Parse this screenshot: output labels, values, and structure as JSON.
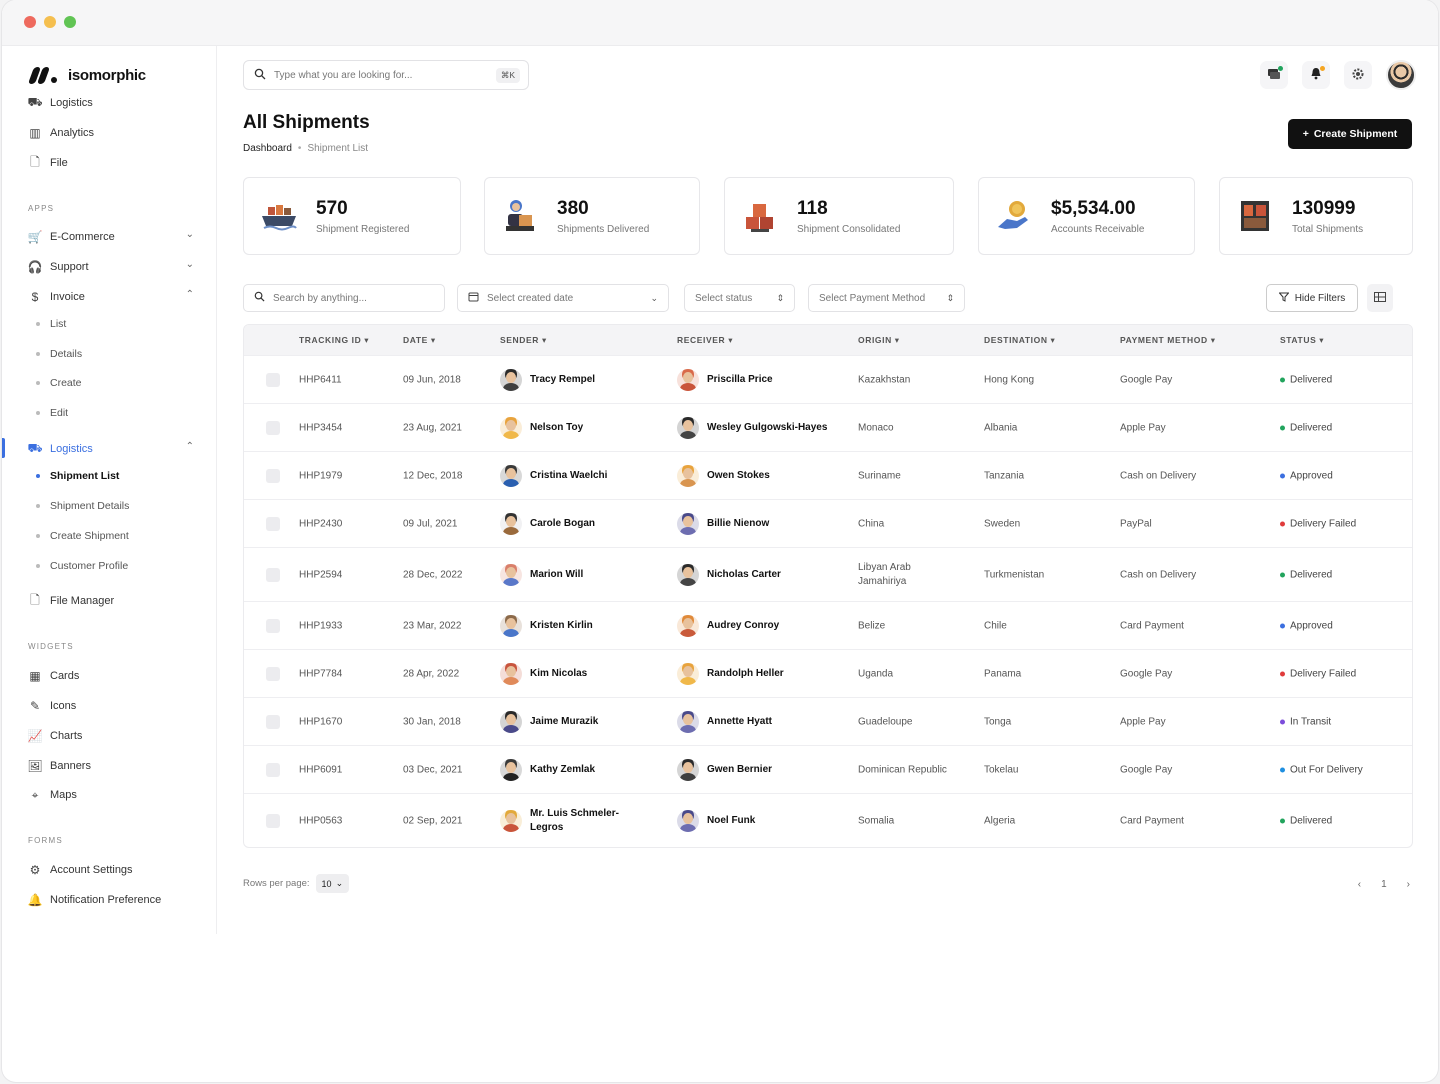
{
  "app": {
    "name": "isomorphic"
  },
  "sidebar": {
    "top_items": [
      {
        "label": "Logistics",
        "icon": "truck-icon"
      },
      {
        "label": "Analytics",
        "icon": "chart-bar-icon"
      },
      {
        "label": "File",
        "icon": "file-icon"
      }
    ],
    "apps_title": "APPS",
    "apps": [
      {
        "label": "E-Commerce",
        "icon": "cart-icon"
      },
      {
        "label": "Support",
        "icon": "headset-icon"
      },
      {
        "label": "Invoice",
        "icon": "dollar-icon"
      }
    ],
    "invoice_sub": [
      "List",
      "Details",
      "Create",
      "Edit"
    ],
    "logistics": {
      "label": "Logistics",
      "icon": "truck-icon"
    },
    "logistics_sub": [
      "Shipment List",
      "Shipment Details",
      "Create Shipment",
      "Customer Profile"
    ],
    "file_manager": "File Manager",
    "widgets_title": "WIDGETS",
    "widgets": [
      {
        "label": "Cards",
        "icon": "grid-icon"
      },
      {
        "label": "Icons",
        "icon": "pen-icon"
      },
      {
        "label": "Charts",
        "icon": "line-chart-icon"
      },
      {
        "label": "Banners",
        "icon": "image-icon"
      },
      {
        "label": "Maps",
        "icon": "map-pin-icon"
      }
    ],
    "forms_title": "FORMS",
    "forms": [
      {
        "label": "Account Settings",
        "icon": "user-gear-icon"
      },
      {
        "label": "Notification Preference",
        "icon": "bell-settings-icon"
      }
    ]
  },
  "header": {
    "search_placeholder": "Type what you are looking for...",
    "shortcut": "⌘K"
  },
  "page": {
    "title": "All Shipments",
    "breadcrumb": [
      "Dashboard",
      "Shipment List"
    ],
    "create_label": "Create Shipment"
  },
  "stats": [
    {
      "value": "570",
      "label": "Shipment Registered"
    },
    {
      "value": "380",
      "label": "Shipments Delivered"
    },
    {
      "value": "118",
      "label": "Shipment Consolidated"
    },
    {
      "value": "$5,534.00",
      "label": "Accounts Receivable"
    },
    {
      "value": "130999",
      "label": "Total Shipments"
    }
  ],
  "filters": {
    "search_placeholder": "Search by anything...",
    "date_placeholder": "Select created date",
    "status_placeholder": "Select status",
    "payment_placeholder": "Select Payment Method",
    "hide_label": "Hide Filters"
  },
  "table": {
    "headers": [
      "TRACKING ID",
      "DATE",
      "SENDER",
      "RECEIVER",
      "ORIGIN",
      "DESTINATION",
      "PAYMENT METHOD",
      "STATUS"
    ],
    "rows": [
      {
        "id": "HHP6411",
        "date": "09 Jun, 2018",
        "sender": "Tracy Rempel",
        "receiver": "Priscilla Price",
        "origin": "Kazakhstan",
        "destination": "Hong Kong",
        "payment": "Google Pay",
        "status": "Delivered"
      },
      {
        "id": "HHP3454",
        "date": "23 Aug, 2021",
        "sender": "Nelson Toy",
        "receiver": "Wesley Gulgowski-Hayes",
        "origin": "Monaco",
        "destination": "Albania",
        "payment": "Apple Pay",
        "status": "Delivered"
      },
      {
        "id": "HHP1979",
        "date": "12 Dec, 2018",
        "sender": "Cristina Waelchi",
        "receiver": "Owen Stokes",
        "origin": "Suriname",
        "destination": "Tanzania",
        "payment": "Cash on Delivery",
        "status": "Approved"
      },
      {
        "id": "HHP2430",
        "date": "09 Jul, 2021",
        "sender": "Carole Bogan",
        "receiver": "Billie Nienow",
        "origin": "China",
        "destination": "Sweden",
        "payment": "PayPal",
        "status": "Delivery Failed"
      },
      {
        "id": "HHP2594",
        "date": "28 Dec, 2022",
        "sender": "Marion Will",
        "receiver": "Nicholas Carter",
        "origin": "Libyan Arab Jamahiriya",
        "destination": "Turkmenistan",
        "payment": "Cash on Delivery",
        "status": "Delivered"
      },
      {
        "id": "HHP1933",
        "date": "23 Mar, 2022",
        "sender": "Kristen Kirlin",
        "receiver": "Audrey Conroy",
        "origin": "Belize",
        "destination": "Chile",
        "payment": "Card Payment",
        "status": "Approved"
      },
      {
        "id": "HHP7784",
        "date": "28 Apr, 2022",
        "sender": "Kim Nicolas",
        "receiver": "Randolph Heller",
        "origin": "Uganda",
        "destination": "Panama",
        "payment": "Google Pay",
        "status": "Delivery Failed"
      },
      {
        "id": "HHP1670",
        "date": "30 Jan, 2018",
        "sender": "Jaime Murazik",
        "receiver": "Annette Hyatt",
        "origin": "Guadeloupe",
        "destination": "Tonga",
        "payment": "Apple Pay",
        "status": "In Transit"
      },
      {
        "id": "HHP6091",
        "date": "03 Dec, 2021",
        "sender": "Kathy Zemlak",
        "receiver": "Gwen Bernier",
        "origin": "Dominican Republic",
        "destination": "Tokelau",
        "payment": "Google Pay",
        "status": "Out For Delivery"
      },
      {
        "id": "HHP0563",
        "date": "02 Sep, 2021",
        "sender": "Mr. Luis Schmeler-Legros",
        "receiver": "Noel Funk",
        "origin": "Somalia",
        "destination": "Algeria",
        "payment": "Card Payment",
        "status": "Delivered"
      }
    ]
  },
  "status_colors": {
    "Delivered": "#22a45d",
    "Approved": "#3b6fe0",
    "Delivery Failed": "#e03b3b",
    "In Transit": "#7c4ddb",
    "Out For Delivery": "#1f8fe0"
  },
  "footer": {
    "rows_label": "Rows per page:",
    "rows_value": "10",
    "page": "1"
  }
}
